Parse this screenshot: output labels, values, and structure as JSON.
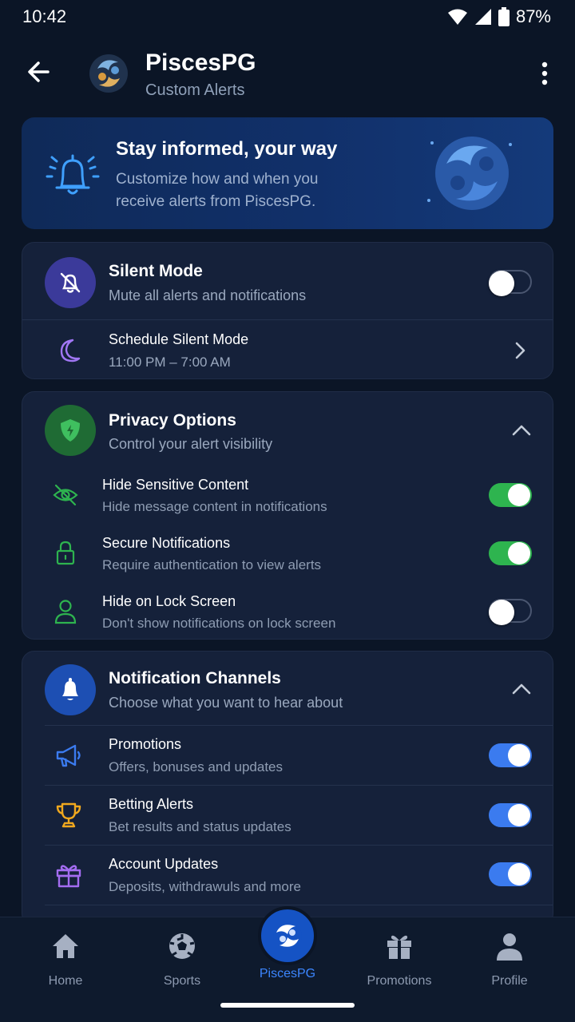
{
  "status_bar": {
    "time": "10:42",
    "battery": "87%"
  },
  "header": {
    "title": "PiscesPG",
    "subtitle": "Custom Alerts"
  },
  "banner": {
    "title": "Stay informed, your way",
    "text": "Customize how and when you receive alerts from PiscesPG."
  },
  "silent_card": {
    "title": "Silent Mode",
    "subtitle": "Mute all alerts and notifications",
    "enabled": false,
    "schedule_title": "Schedule Silent Mode",
    "schedule_time": "11:00 PM – 7:00 AM"
  },
  "privacy_card": {
    "title": "Privacy Options",
    "subtitle": "Control your alert visibility",
    "items": [
      {
        "title": "Hide Sensitive Content",
        "subtitle": "Hide message content in notifications",
        "enabled": true,
        "icon": "eye-off-icon"
      },
      {
        "title": "Secure Notifications",
        "subtitle": "Require authentication to view alerts",
        "enabled": true,
        "icon": "lock-icon"
      },
      {
        "title": "Hide on Lock Screen",
        "subtitle": "Don't show notifications on lock screen",
        "enabled": false,
        "icon": "user-icon"
      }
    ]
  },
  "channels_card": {
    "title": "Notification Channels",
    "subtitle": "Choose what you want to hear about",
    "items": [
      {
        "title": "Promotions",
        "subtitle": "Offers, bonuses and updates",
        "enabled": true,
        "icon": "megaphone-icon"
      },
      {
        "title": "Betting Alerts",
        "subtitle": "Bet results and status updates",
        "enabled": true,
        "icon": "trophy-icon"
      },
      {
        "title": "Account Updates",
        "subtitle": "Deposits, withdrawuls and more",
        "enabled": true,
        "icon": "gift-icon"
      }
    ]
  },
  "bottom_nav": {
    "items": [
      {
        "label": "Home",
        "icon": "home-icon"
      },
      {
        "label": "Sports",
        "icon": "soccer-ball-icon"
      },
      {
        "label": "PiscesPG",
        "icon": "pisces-logo-icon",
        "active": true
      },
      {
        "label": "Promotions",
        "icon": "gift-icon"
      },
      {
        "label": "Profile",
        "icon": "person-icon"
      }
    ]
  },
  "colors": {
    "background": "#0b1526",
    "card": "#15213a",
    "accent_blue": "#3b7bef",
    "accent_green": "#2eb44f",
    "silent_icon_bg": "#3b3a9a",
    "privacy_icon_bg": "#1f6b34",
    "channels_icon_bg": "#1d4fb3"
  }
}
